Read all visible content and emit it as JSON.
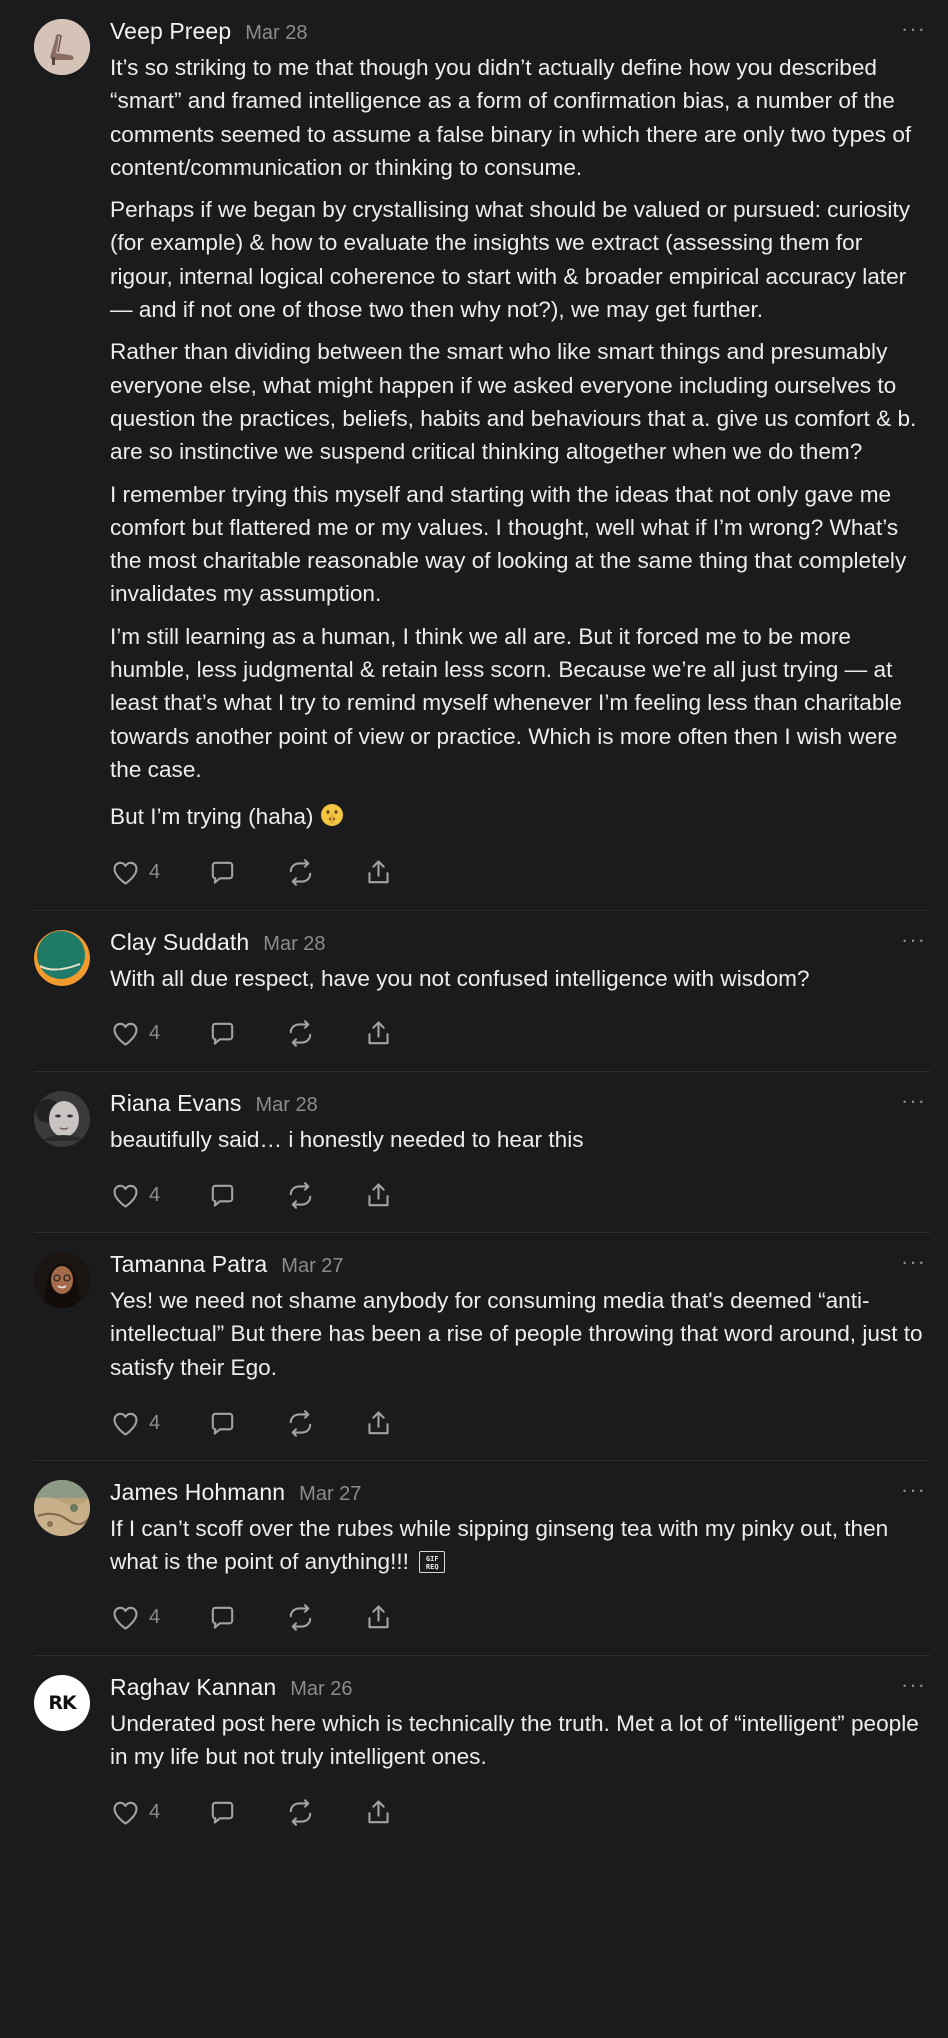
{
  "comments": [
    {
      "author": "Veep Preep",
      "date": "Mar 28",
      "paragraphs": [
        "It’s so striking to me that though you didn’t actually define how you described “smart” and framed intelligence as a form of confirmation bias, a number of the comments seemed to assume a false binary in which there are only two types of content/communication or thinking to consume.",
        "Perhaps if we began by crystallising what should be valued or pursued: curiosity (for example) & how to evaluate the insights we extract (assessing them for rigour, internal logical coherence to start with & broader empirical accuracy later — and if not one of those two then why not?), we may get further.",
        "Rather than dividing between the smart who like smart things and presumably everyone else, what might happen if we asked everyone including ourselves to question the practices, beliefs, habits and behaviours that a. give us comfort & b. are so instinctive we suspend critical thinking altogether when we do them?",
        "I remember trying this myself and starting with the ideas that not only gave me comfort but flattered me or my values. I thought, well what if I’m wrong? What’s the most charitable reasonable way of looking at the same thing that completely invalidates my assumption.",
        "I’m still learning as a human, I think we all are. But it forced me to be more humble, less judgmental & retain less scorn. Because we’re all just trying — at least that’s what I try to remind myself whenever I’m feeling less than charitable towards another point of view or practice. Which is more often then I wish were the case.",
        "But I’m trying (haha)"
      ],
      "like_count": "4",
      "more": "···",
      "avatar_icon": "high-heel-shoe"
    },
    {
      "author": "Clay Suddath",
      "date": "Mar 28",
      "paragraphs": [
        "With all due respect, have you not confused intelligence with wisdom?"
      ],
      "like_count": "4",
      "more": "···",
      "avatar_icon": "teal-orange-circle"
    },
    {
      "author": "Riana Evans",
      "date": "Mar 28",
      "paragraphs": [
        "beautifully said… i honestly needed to hear this"
      ],
      "like_count": "4",
      "more": "···",
      "avatar_icon": "portrait-photo"
    },
    {
      "author": "Tamanna Patra",
      "date": "Mar 27",
      "paragraphs": [
        "Yes! we need not shame anybody for consuming media that's deemed “anti-intellectual” But there has been a rise of people throwing that word around, just to satisfy their Ego."
      ],
      "like_count": "4",
      "more": "···",
      "avatar_icon": "portrait-photo"
    },
    {
      "author": "James Hohmann",
      "date": "Mar 27",
      "paragraphs": [
        "If I can’t scoff over the rubes while sipping ginseng tea with my pinky out, then what is the point of anything!!!"
      ],
      "gif_label": "GIF REQ",
      "like_count": "4",
      "more": "···",
      "avatar_icon": "landscape-photo"
    },
    {
      "author": "Raghav Kannan",
      "date": "Mar 26",
      "paragraphs": [
        "Underated post here which is technically the truth. Met a lot of “intelligent” people in my life but not truly intelligent ones."
      ],
      "avatar_initials": "RK",
      "like_count": "4",
      "more": "···",
      "avatar_icon": "initials"
    }
  ],
  "colors": {
    "background": "#1b1b1d",
    "text": "#ededed",
    "muted": "#8c8c8f",
    "divider": "#2c2c2f"
  },
  "action_icons": [
    "heart-icon",
    "comment-icon",
    "restack-icon",
    "share-icon"
  ]
}
